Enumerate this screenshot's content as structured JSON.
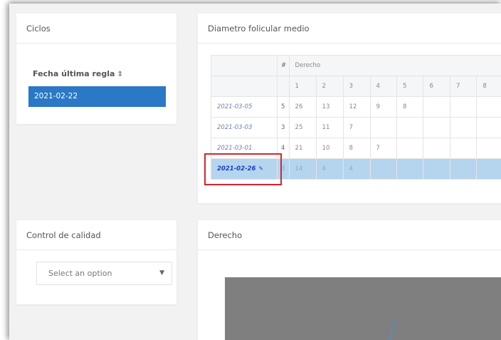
{
  "ciclos": {
    "title": "Ciclos",
    "fur_label": "Fecha última regla",
    "sort_icon": "sort-icon",
    "selected_date": "2021-02-22"
  },
  "diametro": {
    "title": "Diametro folicular medio",
    "hash_label": "#",
    "side_label": "Derecho",
    "columns": [
      "1",
      "2",
      "3",
      "4",
      "5",
      "6",
      "7",
      "8"
    ],
    "rows": [
      {
        "date": "2021-03-05",
        "n": "5",
        "values": [
          "26",
          "13",
          "12",
          "9",
          "8",
          "",
          "",
          ""
        ]
      },
      {
        "date": "2021-03-03",
        "n": "3",
        "values": [
          "25",
          "11",
          "7",
          "",
          "",
          "",
          "",
          ""
        ]
      },
      {
        "date": "2021-03-01",
        "n": "4",
        "values": [
          "21",
          "10",
          "8",
          "7",
          "",
          "",
          "",
          ""
        ]
      },
      {
        "date": "2021-02-26",
        "n": "3",
        "values": [
          "14",
          "4",
          "4",
          "",
          "",
          "",
          "",
          ""
        ],
        "selected": true
      }
    ],
    "highlight_color": "#d9232e",
    "selected_row_color": "#b5d5ef"
  },
  "control": {
    "title": "Control de calidad",
    "select_placeholder": "Select an option"
  },
  "derecho": {
    "title": "Derecho"
  },
  "colors": {
    "primary": "#2a78c6",
    "plot_bg": "#7f7f7f",
    "curve": "#4d8fd6"
  }
}
